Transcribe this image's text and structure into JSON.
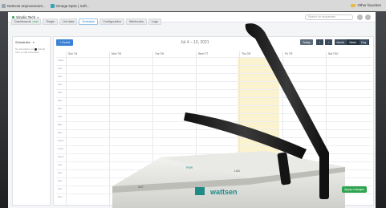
{
  "bookmarks": {
    "items": [
      {
        "label": "NetHost Improvement...",
        "icon": "page-icon",
        "color": "#9aa4ad"
      },
      {
        "label": "Omega Optic | Soft...",
        "icon": "page-icon",
        "color": "#3aa2b8"
      }
    ],
    "other_label": "Other favorites"
  },
  "topbar": {
    "project_name": "Singlio Tech",
    "search_placeholder": "Search for sequences"
  },
  "tabs": [
    {
      "label": "Dashboards",
      "badge": "new",
      "active": false
    },
    {
      "label": "Single",
      "badge": "",
      "active": false
    },
    {
      "label": "List data",
      "badge": "",
      "active": false
    },
    {
      "label": "Schedule",
      "badge": "",
      "active": true
    },
    {
      "label": "Configuration",
      "badge": "",
      "active": false
    },
    {
      "label": "Webhooks",
      "badge": "",
      "active": false
    },
    {
      "label": "Logs",
      "badge": "",
      "active": false
    }
  ],
  "sidebar": {
    "title": "Schedules",
    "note_1": "No schedules yet",
    "note_2": "Upload here to add schedules"
  },
  "calendar": {
    "add_label": "+ Event",
    "range_label": "Jul 4 – 10, 2021",
    "today_label": "Today",
    "prev_label": "‹",
    "next_label": "›",
    "views": [
      "Month",
      "Week",
      "Day"
    ],
    "active_view": "Week",
    "days": [
      "Sun 7/4",
      "Mon 7/5",
      "Tue 7/6",
      "Wed 7/7",
      "Thu 7/8",
      "Fri 7/9",
      "Sat 7/10"
    ],
    "highlighted_day": "Thu 7/8",
    "times": [
      "12am",
      "1am",
      "2am",
      "3am",
      "4am",
      "5am",
      "6am",
      "7am",
      "8am",
      "9am",
      "10am",
      "11am",
      "12pm",
      "1pm",
      "2pm",
      "3pm",
      "4pm",
      "5pm"
    ]
  },
  "apply_label": "Apply changes",
  "device": {
    "brand": "wattsen",
    "port_labels": [
      "PWR",
      "ANT",
      "LAN"
    ]
  },
  "colors": {
    "accent": "#3b82d6",
    "success": "#2ea44f",
    "nav_dark": "#3a4b5e",
    "highlight": "#fbf3cf"
  }
}
